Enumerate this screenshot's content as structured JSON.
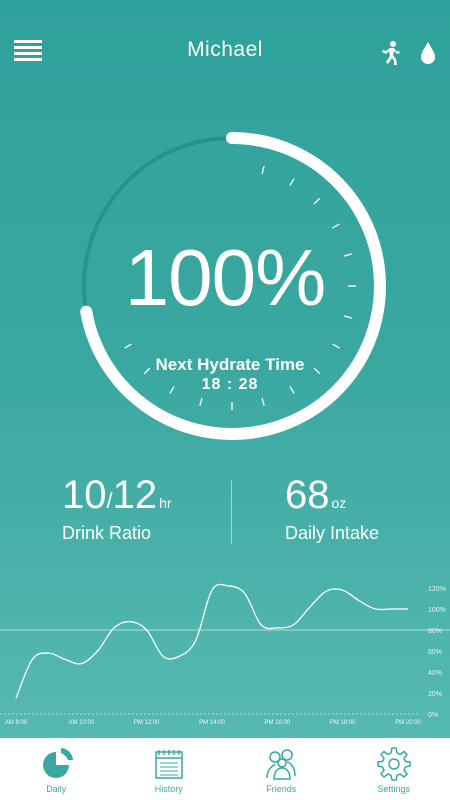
{
  "header": {
    "user_name": "Michael"
  },
  "progress": {
    "percent_text": "100%",
    "percent_value": 100
  },
  "hydrate": {
    "label": "Next Hydrate Time",
    "time": "18 : 28"
  },
  "stats": {
    "drink_ratio": {
      "value_a": "10",
      "value_b": "12",
      "unit": "hr",
      "label": "Drink Ratio"
    },
    "daily_intake": {
      "value": "68",
      "unit": "oz",
      "label": "Daily Intake"
    }
  },
  "chart_data": {
    "type": "line",
    "x_labels": [
      "AM 8:00",
      "AM 10:00",
      "PM 12:00",
      "PM 14:00",
      "PM 16:00",
      "PM 18:00",
      "PM 20:00"
    ],
    "y_labels": [
      "120%",
      "100%",
      "80%",
      "60%",
      "40%",
      "20%",
      "0%"
    ],
    "ylim": [
      0,
      120
    ],
    "reference_line": 80,
    "series": [
      {
        "x": [
          0,
          0.25,
          0.5,
          0.75,
          1.0,
          1.25,
          1.5,
          1.75,
          2.0,
          2.25,
          2.5,
          2.75,
          3.0,
          3.25,
          3.5,
          3.75,
          4.0,
          4.25,
          4.5,
          4.75,
          5.0,
          5.25,
          5.5,
          5.75,
          6.0
        ],
        "values": [
          15,
          52,
          58,
          52,
          48,
          60,
          82,
          88,
          80,
          55,
          55,
          70,
          118,
          122,
          115,
          85,
          82,
          85,
          102,
          117,
          118,
          108,
          100,
          100,
          100
        ]
      }
    ]
  },
  "nav": [
    {
      "label": "Daily",
      "icon": "pie-chart-icon"
    },
    {
      "label": "History",
      "icon": "calendar-icon"
    },
    {
      "label": "Friends",
      "icon": "friends-icon"
    },
    {
      "label": "Settings",
      "icon": "gear-icon"
    }
  ],
  "colors": {
    "teal": "#3aa8a0",
    "white": "#ffffff"
  }
}
